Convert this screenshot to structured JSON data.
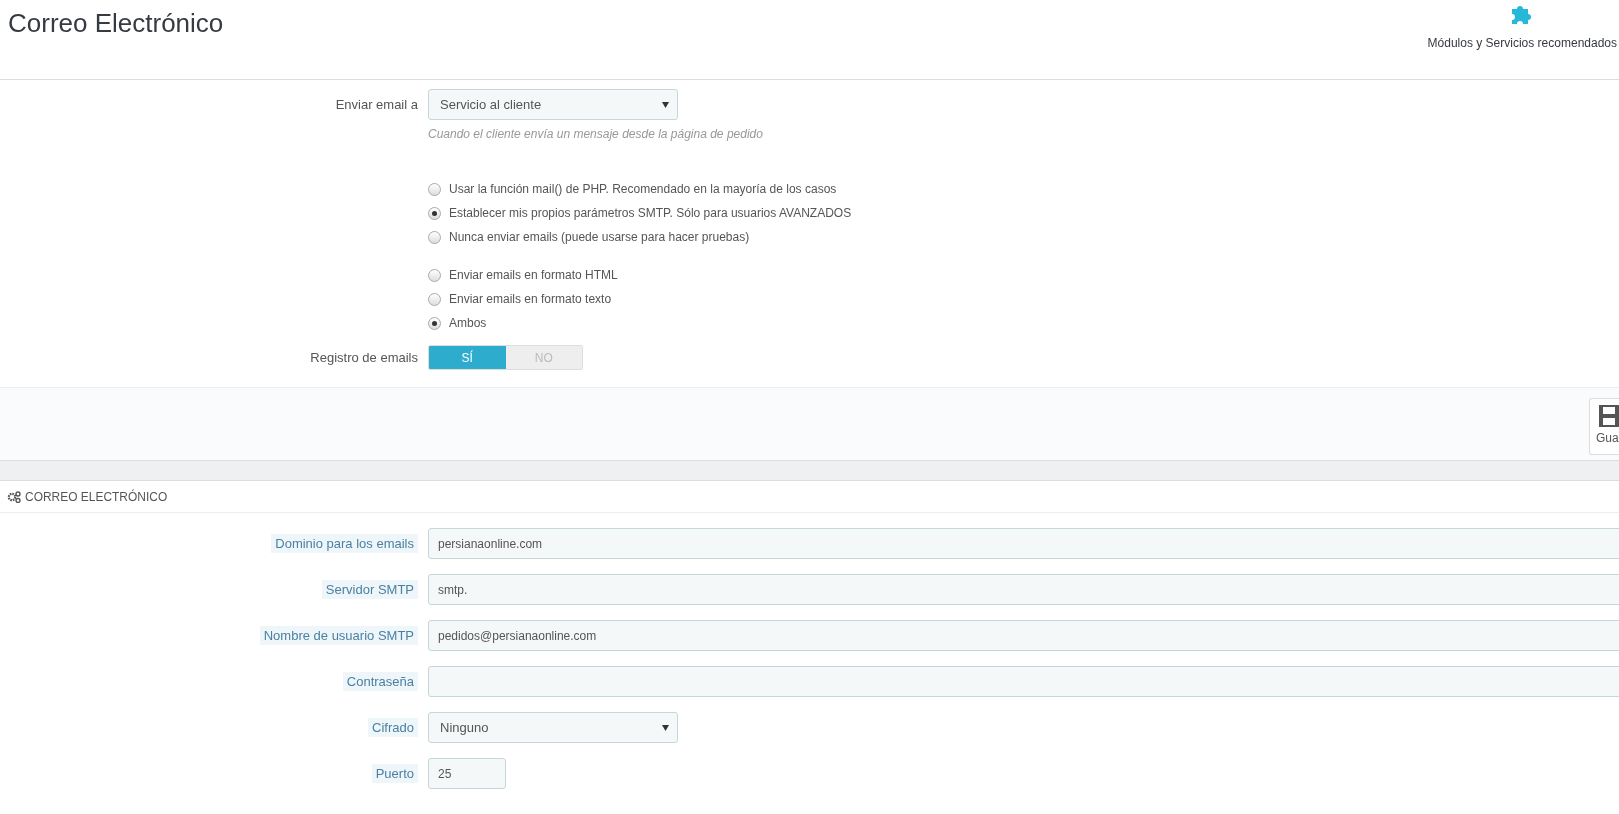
{
  "header": {
    "title": "Correo Electrónico",
    "toolbar_link": "Módulos y Servicios recomendados"
  },
  "options_form": {
    "send_to": {
      "label": "Enviar email a",
      "value": "Servicio al cliente",
      "help": "Cuando el cliente envía un mensaje desde la página de pedido"
    },
    "method_options": [
      {
        "label": "Usar la función mail() de PHP. Recomendado en la mayoría de los casos",
        "selected": false
      },
      {
        "label": "Establecer mis propios parámetros SMTP. Sólo para usuarios AVANZADOS",
        "selected": true
      },
      {
        "label": "Nunca enviar emails (puede usarse para hacer pruebas)",
        "selected": false
      }
    ],
    "format_options": [
      {
        "label": "Enviar emails en formato HTML",
        "selected": false
      },
      {
        "label": "Enviar emails en formato texto",
        "selected": false
      },
      {
        "label": "Ambos",
        "selected": true
      }
    ],
    "log": {
      "label": "Registro de emails",
      "yes": "SÍ",
      "no": "NO",
      "on": true
    }
  },
  "footer": {
    "save_button": "Gua"
  },
  "email_panel": {
    "title": "CORREO ELECTRÓNICO",
    "fields": [
      {
        "kind": "text",
        "label": "Dominio para los emails",
        "value": "persianaonline.com"
      },
      {
        "kind": "text",
        "label": "Servidor SMTP",
        "value": "smtp."
      },
      {
        "kind": "text",
        "label": "Nombre de usuario SMTP",
        "value": "pedidos@persianaonline.com"
      },
      {
        "kind": "password",
        "label": "Contraseña"
      },
      {
        "kind": "select",
        "label": "Cifrado",
        "value": "Ninguno"
      },
      {
        "kind": "short",
        "label": "Puerto",
        "value": "25"
      }
    ]
  }
}
